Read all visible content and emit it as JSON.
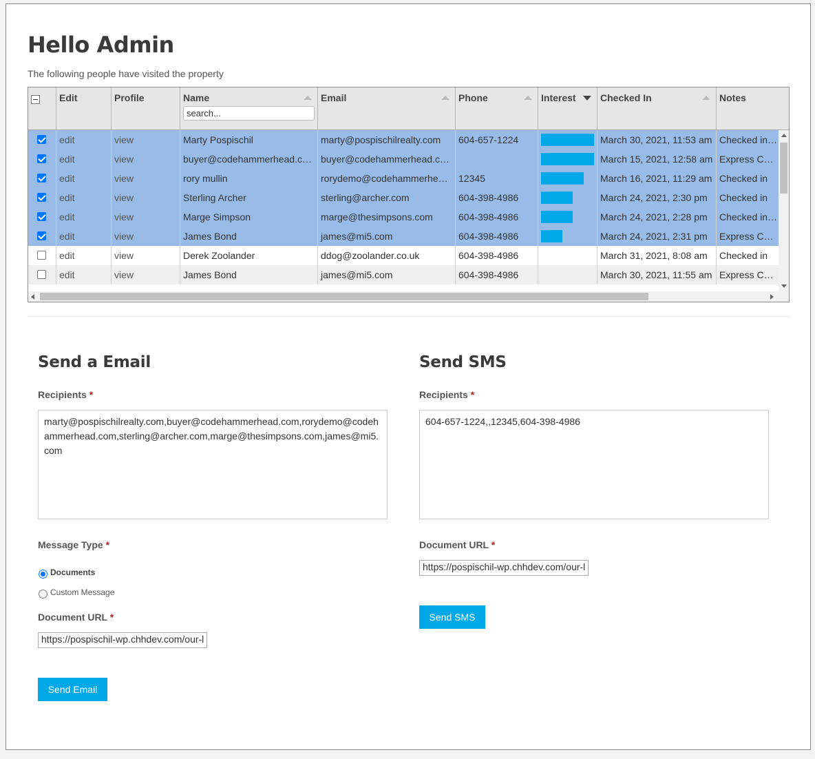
{
  "header": {
    "title": "Hello Admin",
    "subtitle": "The following people have visited the property"
  },
  "grid": {
    "columns": {
      "edit": "Edit",
      "profile": "Profile",
      "name": "Name",
      "email": "Email",
      "phone": "Phone",
      "interest": "Interest",
      "checked_in": "Checked In",
      "notes": "Notes"
    },
    "name_search_placeholder": "search...",
    "rows": [
      {
        "selected": true,
        "edit": "edit",
        "profile": "view",
        "name": "Marty Pospischil",
        "email": "marty@pospischilrealty.com",
        "phone": "604-657-1224",
        "interest": 5,
        "checked_in": "March 30, 2021, 11:53 am",
        "notes": "Checked in Te"
      },
      {
        "selected": true,
        "edit": "edit",
        "profile": "view",
        "name": "buyer@codehammerhead.c…",
        "email": "buyer@codehammerhead.c…",
        "phone": "",
        "interest": 5,
        "checked_in": "March 15, 2021, 12:58 am",
        "notes": "Express Chec"
      },
      {
        "selected": true,
        "edit": "edit",
        "profile": "view",
        "name": "rory mullin",
        "email": "rorydemo@codehammerhe…",
        "phone": "12345",
        "interest": 4,
        "checked_in": "March 16, 2021, 11:29 am",
        "notes": "Checked in"
      },
      {
        "selected": true,
        "edit": "edit",
        "profile": "view",
        "name": "Sterling Archer",
        "email": "sterling@archer.com",
        "phone": "604-398-4986",
        "interest": 3,
        "checked_in": "March 24, 2021, 2:30 pm",
        "notes": "Checked in"
      },
      {
        "selected": true,
        "edit": "edit",
        "profile": "view",
        "name": "Marge Simpson",
        "email": "marge@thesimpsons.com",
        "phone": "604-398-4986",
        "interest": 3,
        "checked_in": "March 24, 2021, 2:28 pm",
        "notes": "Checked in. S"
      },
      {
        "selected": true,
        "edit": "edit",
        "profile": "view",
        "name": "James Bond",
        "email": "james@mi5.com",
        "phone": "604-398-4986",
        "interest": 2,
        "checked_in": "March 24, 2021, 2:31 pm",
        "notes": "Express Chec"
      },
      {
        "selected": false,
        "edit": "edit",
        "profile": "view",
        "name": "Derek Zoolander",
        "email": "ddog@zoolander.co.uk",
        "phone": "604-398-4986",
        "interest": 0,
        "checked_in": "March 31, 2021, 8:08 am",
        "notes": "Checked in"
      },
      {
        "selected": false,
        "edit": "edit",
        "profile": "view",
        "name": "James Bond",
        "email": "james@mi5.com",
        "phone": "604-398-4986",
        "interest": 0,
        "checked_in": "March 30, 2021, 11:55 am",
        "notes": "Express Chec"
      }
    ],
    "interest_max": 5,
    "interest_color": "#00a8e8",
    "selected_row_color": "#99bbe8"
  },
  "email_form": {
    "title": "Send a Email",
    "recipients_label": "Recipients",
    "required_mark": "*",
    "recipients": "marty@pospischilrealty.com,buyer@codehammerhead.com,rorydemo@codehammerhead.com,sterling@archer.com,marge@thesimpsons.com,james@mi5.com",
    "message_type_label": "Message Type",
    "message_types": [
      {
        "label": "Documents",
        "checked": true
      },
      {
        "label": "Custom Message",
        "checked": false
      }
    ],
    "document_url_label": "Document URL",
    "document_url": "https://pospischil-wp.chhdev.com/our-l",
    "send_label": "Send Email"
  },
  "sms_form": {
    "title": "Send SMS",
    "recipients_label": "Recipients",
    "required_mark": "*",
    "recipients": "604-657-1224,,12345,604-398-4986",
    "document_url_label": "Document URL",
    "document_url": "https://pospischil-wp.chhdev.com/our-l",
    "send_label": "Send SMS"
  },
  "colors": {
    "accent": "#00a8e8",
    "selection": "#99bbe8"
  }
}
